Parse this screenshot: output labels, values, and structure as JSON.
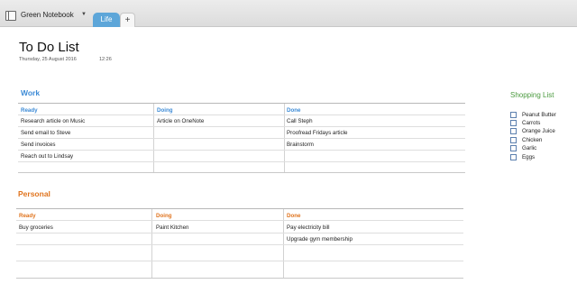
{
  "notebook": {
    "name": "Green Notebook",
    "tabs": [
      {
        "label": "Life",
        "active": true
      }
    ],
    "add_label": "+"
  },
  "page": {
    "title": "To Do List",
    "date": "Thursday, 25 August 2016",
    "time": "12:26"
  },
  "work": {
    "title": "Work",
    "headers": [
      "Ready",
      "Doing",
      "Done"
    ],
    "rows": [
      [
        "Research article on Music",
        "Article on OneNote",
        "Call Steph"
      ],
      [
        "Send email to Steve",
        "",
        "Proofread Fridays article"
      ],
      [
        "Send invoices",
        "",
        "Brainstorm"
      ],
      [
        "Reach out to Lindsay",
        "",
        ""
      ]
    ]
  },
  "personal": {
    "title": "Personal",
    "headers": [
      "Ready",
      "Doing",
      "Done"
    ],
    "rows": [
      [
        "Buy groceries",
        "Paint Kitchen",
        "Pay electricity bill"
      ],
      [
        "",
        "",
        "Upgrade gym membership"
      ]
    ]
  },
  "shopping": {
    "title": "Shopping List",
    "items": [
      "Peanut Butter",
      "Carrots",
      "Orange Juice",
      "Chicken",
      "Garlic",
      "Eggs"
    ]
  },
  "colors": {
    "work_accent": "#3d8bd6",
    "personal_accent": "#e0741e",
    "shopping_accent": "#4a9a3e",
    "tab_active": "#5da6d9"
  }
}
